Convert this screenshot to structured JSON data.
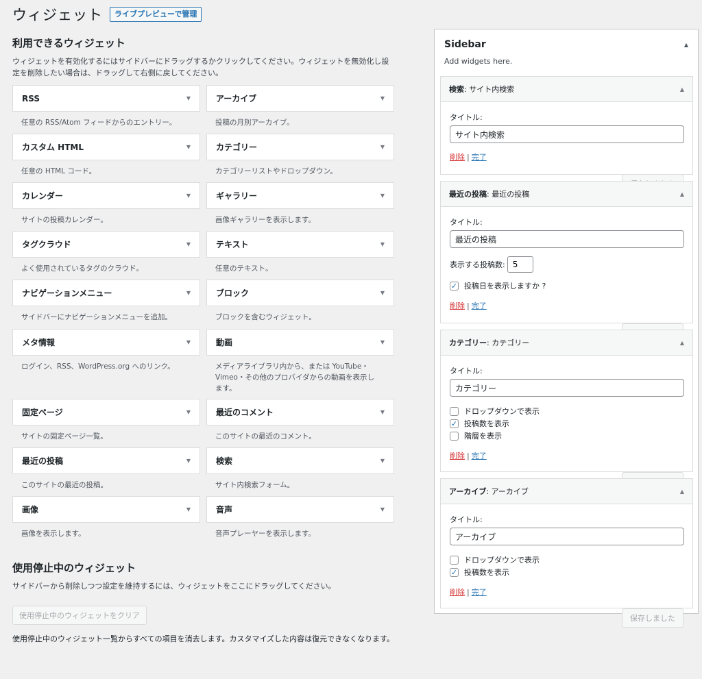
{
  "header": {
    "title": "ウィジェット",
    "live_preview": "ライブプレビューで管理"
  },
  "available": {
    "title": "利用できるウィジェット",
    "desc": "ウィジェットを有効化するにはサイドバーにドラッグするかクリックしてください。ウィジェットを無効化し設定を削除したい場合は、ドラッグして右側に戻してください。",
    "left": [
      {
        "name": "RSS",
        "desc": "任意の RSS/Atom フィードからのエントリー。"
      },
      {
        "name": "カスタム HTML",
        "desc": "任意の HTML コード。"
      },
      {
        "name": "カレンダー",
        "desc": "サイトの投稿カレンダー。"
      },
      {
        "name": "タグクラウド",
        "desc": "よく使用されているタグのクラウド。"
      },
      {
        "name": "ナビゲーションメニュー",
        "desc": "サイドバーにナビゲーションメニューを追加。"
      },
      {
        "name": "メタ情報",
        "desc": "ログイン、RSS、WordPress.org へのリンク。"
      },
      {
        "name": "固定ページ",
        "desc": "サイトの固定ページ一覧。"
      },
      {
        "name": "最近の投稿",
        "desc": "このサイトの最近の投稿。"
      },
      {
        "name": "画像",
        "desc": "画像を表示します。"
      }
    ],
    "right": [
      {
        "name": "アーカイブ",
        "desc": "投稿の月別アーカイブ。"
      },
      {
        "name": "カテゴリー",
        "desc": "カテゴリーリストやドロップダウン。"
      },
      {
        "name": "ギャラリー",
        "desc": "画像ギャラリーを表示します。"
      },
      {
        "name": "テキスト",
        "desc": "任意のテキスト。"
      },
      {
        "name": "ブロック",
        "desc": "ブロックを含むウィジェット。"
      },
      {
        "name": "動画",
        "desc": "メディアライブラリ内から、または YouTube・Vimeo・その他のプロバイダからの動画を表示します。"
      },
      {
        "name": "最近のコメント",
        "desc": "このサイトの最近のコメント。"
      },
      {
        "name": "検索",
        "desc": "サイト内検索フォーム。"
      },
      {
        "name": "音声",
        "desc": "音声プレーヤーを表示します。"
      }
    ]
  },
  "inactive": {
    "title": "使用停止中のウィジェット",
    "desc": "サイドバーから削除しつつ設定を維持するには、ウィジェットをここにドラッグしてください。",
    "clear_button": "使用停止中のウィジェットをクリア",
    "note": "使用停止中のウィジェット一覧からすべての項目を消去します。カスタマイズした内容は復元できなくなります。"
  },
  "sidebar": {
    "title": "Sidebar",
    "desc": "Add widgets here.",
    "title_label": "タイトル:",
    "delete": "削除",
    "done": "完了",
    "saved": "保存しました",
    "widgets": {
      "search": {
        "name": "検索",
        "sub": ": サイト内検索",
        "title_value": "サイト内検索"
      },
      "recent": {
        "name": "最近の投稿",
        "sub": ": 最近の投稿",
        "title_value": "最近の投稿",
        "count_label": "表示する投稿数:",
        "count_value": "5",
        "show_date": "投稿日を表示しますか ?"
      },
      "category": {
        "name": "カテゴリー",
        "sub": ": カテゴリー",
        "title_value": "カテゴリー",
        "opt_dropdown": "ドロップダウンで表示",
        "opt_count": "投稿数を表示",
        "opt_hierarchy": "階層を表示"
      },
      "archive": {
        "name": "アーカイブ",
        "sub": ": アーカイブ",
        "title_value": "アーカイブ",
        "opt_dropdown": "ドロップダウンで表示",
        "opt_count": "投稿数を表示"
      }
    }
  }
}
